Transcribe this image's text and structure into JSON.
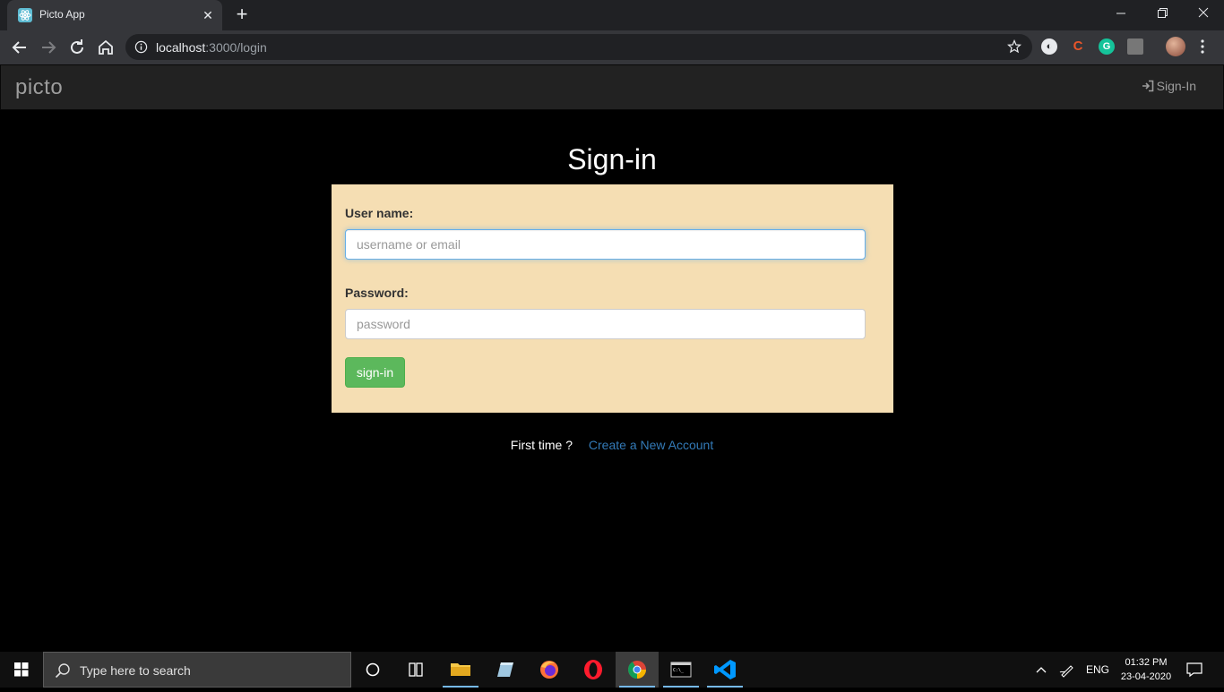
{
  "browser": {
    "tab_title": "Picto App",
    "url_host": "localhost",
    "url_path": ":3000/login"
  },
  "navbar": {
    "brand": "picto",
    "signin_label": "Sign-In"
  },
  "login": {
    "title": "Sign-in",
    "username_label": "User name:",
    "username_placeholder": "username or email",
    "password_label": "Password:",
    "password_placeholder": "password",
    "submit_label": "sign-in",
    "first_time_text": "First time ?",
    "create_account_label": "Create a New Account"
  },
  "taskbar": {
    "search_placeholder": "Type here to search",
    "language": "ENG",
    "time": "01:32 PM",
    "date": "23-04-2020"
  },
  "colors": {
    "panel_bg": "#f5deb3",
    "submit_bg": "#5cb85c",
    "link": "#337ab7",
    "navbar_bg": "#222222"
  }
}
